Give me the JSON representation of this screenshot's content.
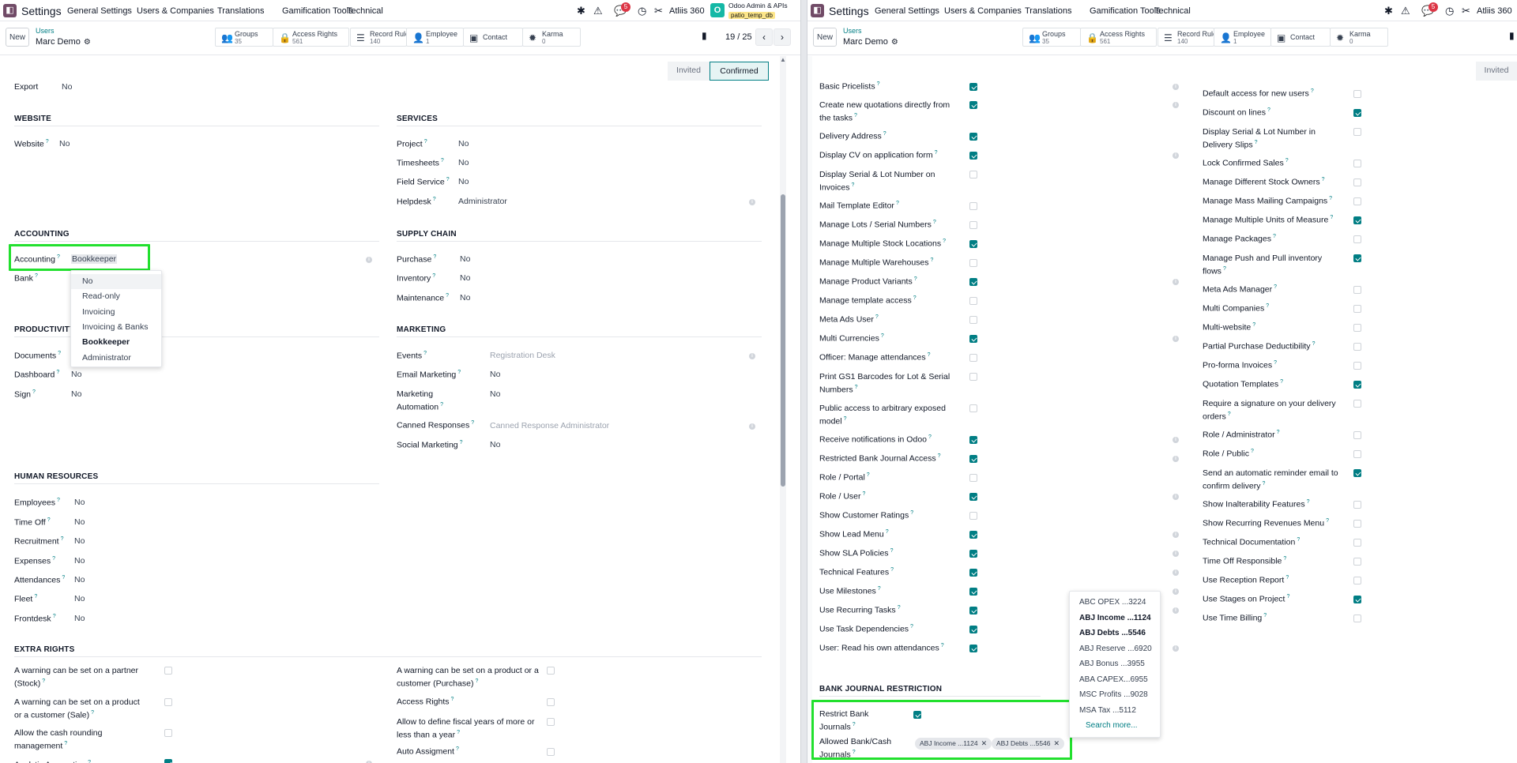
{
  "navbar": {
    "app_name": "Settings",
    "menus": [
      "General Settings",
      "Users & Companies",
      "Translations",
      "Gamification Tools",
      "Technical"
    ],
    "chat_badge": "5",
    "company_top": "Odoo Admin & APIs",
    "company_db": "patio_temp_db",
    "company_name": "Atliis 360",
    "avatar_letter": "O",
    "accent": "#714b67"
  },
  "controlpanel": {
    "new_label": "New",
    "breadcrumb": "Users",
    "record_name": "Marc Demo",
    "smart_buttons": [
      {
        "icon": "users-icon",
        "label": "Groups",
        "value": "35"
      },
      {
        "icon": "lock-icon",
        "label": "Access Rights",
        "value": "561"
      },
      {
        "icon": "list-icon",
        "label": "Record Rules",
        "value": "140"
      },
      {
        "icon": "employee-icon",
        "label": "Employee",
        "value": "1"
      },
      {
        "icon": "contact-icon",
        "label": "Contact",
        "value": ""
      },
      {
        "icon": "karma-icon",
        "label": "Karma",
        "value": "0"
      }
    ],
    "pager": "19 / 25"
  },
  "status": {
    "invited": "Invited",
    "confirmed": "Confirmed"
  },
  "left": {
    "export": {
      "label": "Export",
      "value": "No"
    },
    "website": {
      "title": "WEBSITE",
      "fields": [
        {
          "label": "Website",
          "value": "No"
        }
      ]
    },
    "services": {
      "title": "SERVICES",
      "fields": [
        {
          "label": "Project",
          "value": "No"
        },
        {
          "label": "Timesheets",
          "value": "No"
        },
        {
          "label": "Field Service",
          "value": "No"
        },
        {
          "label": "Helpdesk",
          "value": "Administrator"
        }
      ]
    },
    "accounting": {
      "title": "ACCOUNTING",
      "fields": [
        {
          "label": "Accounting",
          "value": "Bookkeeper"
        },
        {
          "label": "Bank",
          "value": ""
        }
      ]
    },
    "accounting_options": [
      "No",
      "Read-only",
      "Invoicing",
      "Invoicing & Banks",
      "Bookkeeper",
      "Administrator"
    ],
    "supply_chain": {
      "title": "SUPPLY CHAIN",
      "fields": [
        {
          "label": "Purchase",
          "value": "No"
        },
        {
          "label": "Inventory",
          "value": "No"
        },
        {
          "label": "Maintenance",
          "value": "No"
        }
      ]
    },
    "productivity": {
      "title": "PRODUCTIVITY",
      "fields": [
        {
          "label": "Documents",
          "value": ""
        },
        {
          "label": "Dashboard",
          "value": "No"
        },
        {
          "label": "Sign",
          "value": "No"
        }
      ]
    },
    "marketing": {
      "title": "MARKETING",
      "fields": [
        {
          "label": "Events",
          "value": "Registration Desk"
        },
        {
          "label": "Email Marketing",
          "value": "No"
        },
        {
          "label": "Marketing Automation",
          "value": "No"
        },
        {
          "label": "Canned Responses",
          "value": "Canned Response Administrator"
        },
        {
          "label": "Social Marketing",
          "value": "No"
        }
      ]
    },
    "hr": {
      "title": "HUMAN RESOURCES",
      "fields": [
        {
          "label": "Employees",
          "value": "No"
        },
        {
          "label": "Time Off",
          "value": "No"
        },
        {
          "label": "Recruitment",
          "value": "No"
        },
        {
          "label": "Expenses",
          "value": "No"
        },
        {
          "label": "Attendances",
          "value": "No"
        },
        {
          "label": "Fleet",
          "value": "No"
        },
        {
          "label": "Frontdesk",
          "value": "No"
        }
      ]
    },
    "extra": {
      "title": "EXTRA RIGHTS",
      "left": [
        {
          "label": "A warning can be set on a partner (Stock)",
          "checked": false
        },
        {
          "label": "A warning can be set on a product or a customer (Sale)",
          "checked": false
        },
        {
          "label": "Allow the cash rounding management",
          "checked": false
        },
        {
          "label": "Analytic Accounting",
          "checked": true
        }
      ],
      "right": [
        {
          "label": "A warning can be set on a product or a customer (Purchase)",
          "checked": false
        },
        {
          "label": "Access Rights",
          "checked": false
        },
        {
          "label": "Allow to define fiscal years of more or less than a year",
          "checked": false
        },
        {
          "label": "Auto Assigment",
          "checked": false
        }
      ]
    }
  },
  "right": {
    "col1": [
      {
        "label": "Basic Pricelists",
        "checked": true
      },
      {
        "label": "Create new quotations directly from the tasks",
        "checked": true
      },
      {
        "label": "Delivery Address",
        "checked": true
      },
      {
        "label": "Display CV on application form",
        "checked": true
      },
      {
        "label": "Display Serial & Lot Number on Invoices",
        "checked": false
      },
      {
        "label": "Mail Template Editor",
        "checked": false
      },
      {
        "label": "Manage Lots / Serial Numbers",
        "checked": false
      },
      {
        "label": "Manage Multiple Stock Locations",
        "checked": true
      },
      {
        "label": "Manage Multiple Warehouses",
        "checked": false
      },
      {
        "label": "Manage Product Variants",
        "checked": true
      },
      {
        "label": "Manage template access",
        "checked": false
      },
      {
        "label": "Meta Ads User",
        "checked": false
      },
      {
        "label": "Multi Currencies",
        "checked": true
      },
      {
        "label": "Officer: Manage attendances",
        "checked": false
      },
      {
        "label": "Print GS1 Barcodes for Lot & Serial Numbers",
        "checked": false
      },
      {
        "label": "Public access to arbitrary exposed model",
        "checked": false
      },
      {
        "label": "Receive notifications in Odoo",
        "checked": true
      },
      {
        "label": "Restricted Bank Journal Access",
        "checked": true
      },
      {
        "label": "Role / Portal",
        "checked": false
      },
      {
        "label": "Role / User",
        "checked": true
      },
      {
        "label": "Show Customer Ratings",
        "checked": false
      },
      {
        "label": "Show Lead Menu",
        "checked": true
      },
      {
        "label": "Show SLA Policies",
        "checked": true
      },
      {
        "label": "Technical Features",
        "checked": true
      },
      {
        "label": "Use Milestones",
        "checked": true
      },
      {
        "label": "Use Recurring Tasks",
        "checked": true
      },
      {
        "label": "Use Task Dependencies",
        "checked": true
      },
      {
        "label": "User: Read his own attendances",
        "checked": true
      }
    ],
    "col2": [
      {
        "label": "Default access for new users",
        "checked": false
      },
      {
        "label": "Discount on lines",
        "checked": true
      },
      {
        "label": "Display Serial & Lot Number in Delivery Slips",
        "checked": false
      },
      {
        "label": "Lock Confirmed Sales",
        "checked": false
      },
      {
        "label": "Manage Different Stock Owners",
        "checked": false
      },
      {
        "label": "Manage Mass Mailing Campaigns",
        "checked": false
      },
      {
        "label": "Manage Multiple Units of Measure",
        "checked": true
      },
      {
        "label": "Manage Packages",
        "checked": false
      },
      {
        "label": "Manage Push and Pull inventory flows",
        "checked": true
      },
      {
        "label": "Meta Ads Manager",
        "checked": false
      },
      {
        "label": "Multi Companies",
        "checked": false
      },
      {
        "label": "Multi-website",
        "checked": false
      },
      {
        "label": "Partial Purchase Deductibility",
        "checked": false
      },
      {
        "label": "Pro-forma Invoices",
        "checked": false
      },
      {
        "label": "Quotation Templates",
        "checked": true
      },
      {
        "label": "Require a signature on your delivery orders",
        "checked": false
      },
      {
        "label": "Role / Administrator",
        "checked": false
      },
      {
        "label": "Role / Public",
        "checked": false
      },
      {
        "label": "Send an automatic reminder email to confirm delivery",
        "checked": true
      },
      {
        "label": "Show Inalterability Features",
        "checked": false
      },
      {
        "label": "Show Recurring Revenues Menu",
        "checked": false
      },
      {
        "label": "Technical Documentation",
        "checked": false
      },
      {
        "label": "Time Off Responsible",
        "checked": false
      },
      {
        "label": "Use Reception Report",
        "checked": false
      },
      {
        "label": "Use Stages on Project",
        "checked": true
      },
      {
        "label": "Use Time Billing",
        "checked": false
      }
    ],
    "bank": {
      "title": "BANK JOURNAL RESTRICTION",
      "restrict_label": "Restrict Bank Journals",
      "allowed_label": "Allowed Bank/Cash Journals",
      "tags": [
        "ABJ Income ...1124",
        "ABJ Debts ...5546"
      ]
    },
    "journal_options": [
      {
        "label": "ABC OPEX ...3224",
        "bold": false
      },
      {
        "label": "ABJ Income ...1124",
        "bold": true
      },
      {
        "label": "ABJ Debts ...5546",
        "bold": true
      },
      {
        "label": "ABJ Reserve ...6920",
        "bold": false
      },
      {
        "label": "ABJ Bonus ...3955",
        "bold": false
      },
      {
        "label": "ABA CAPEX...6955",
        "bold": false
      },
      {
        "label": "MSC Profits ...9028",
        "bold": false
      },
      {
        "label": "MSA Tax ...5112",
        "bold": false
      }
    ],
    "search_more": "Search more..."
  },
  "colors": {
    "teal": "#017e84",
    "highlight": "#22e02e"
  }
}
